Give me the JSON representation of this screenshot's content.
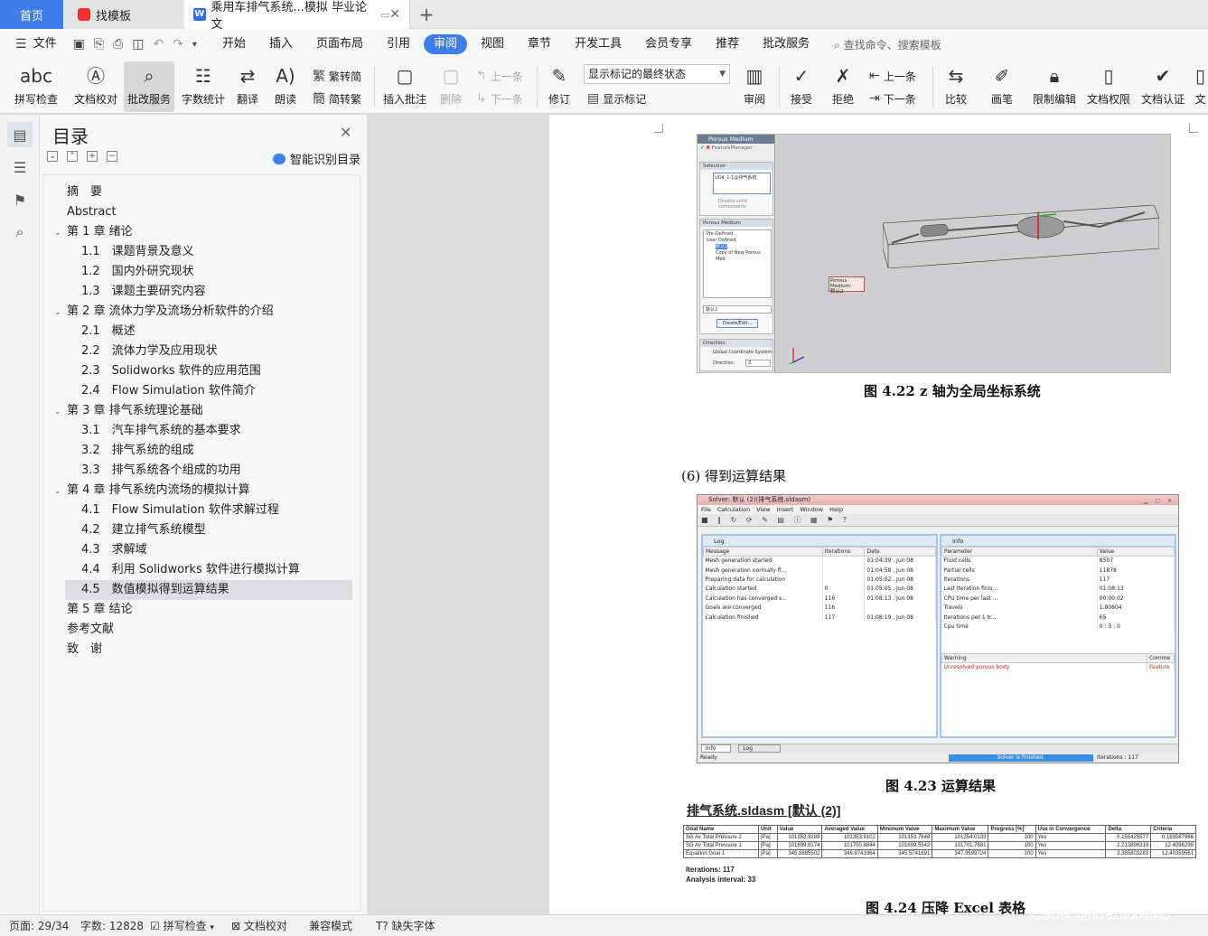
{
  "tabs": {
    "home": "首页",
    "template": "找模板",
    "document": "乘用车排气系统...模拟 毕业论文"
  },
  "menu": {
    "file": "文件",
    "items": [
      "开始",
      "插入",
      "页面布局",
      "引用",
      "审阅",
      "视图",
      "章节",
      "开发工具",
      "会员专享",
      "推荐",
      "批改服务"
    ],
    "active": "审阅",
    "search": "查找命令、搜索模板"
  },
  "ribbon": {
    "spell": "拼写检查",
    "doc_check": "文档校对",
    "correct": "批改服务",
    "word_count": "字数统计",
    "translate": "翻译",
    "read": "朗读",
    "trad": "繁转简",
    "simp": "简转繁",
    "insert_comment": "插入批注",
    "delete": "删除",
    "prev": "上一条",
    "next": "下一条",
    "revise": "修订",
    "markup_state": "显示标记的最终状态",
    "show_markup": "显示标记",
    "review": "审阅",
    "accept": "接受",
    "reject": "拒绝",
    "prev2": "上一条",
    "next2": "下一条",
    "compare": "比较",
    "pen": "画笔",
    "restrict": "限制编辑",
    "perm": "文档权限",
    "cert": "文档认证",
    "more": "文"
  },
  "toc": {
    "title": "目录",
    "smart": "智能识别目录",
    "items": [
      {
        "label": "摘　要",
        "level": 1,
        "arrow": false
      },
      {
        "label": "Abstract",
        "level": 1,
        "arrow": false
      },
      {
        "label": "第 1 章  绪论",
        "level": 1,
        "arrow": true
      },
      {
        "label": "1.1　课题背景及意义",
        "level": 2,
        "arrow": false
      },
      {
        "label": "1.2　国内外研究现状",
        "level": 2,
        "arrow": false
      },
      {
        "label": "1.3　课题主要研究内容",
        "level": 2,
        "arrow": false
      },
      {
        "label": "第 2 章  流体力学及流场分析软件的介绍",
        "level": 1,
        "arrow": true
      },
      {
        "label": "2.1　概述",
        "level": 2,
        "arrow": false
      },
      {
        "label": "2.2　流体力学及应用现状",
        "level": 2,
        "arrow": false
      },
      {
        "label": "2.3　Solidworks 软件的应用范围",
        "level": 2,
        "arrow": false
      },
      {
        "label": "2.4　Flow Simulation  软件简介",
        "level": 2,
        "arrow": false
      },
      {
        "label": "第 3 章  排气系统理论基础",
        "level": 1,
        "arrow": true
      },
      {
        "label": "3.1　汽车排气系统的基本要求",
        "level": 2,
        "arrow": false
      },
      {
        "label": "3.2　排气系统的组成",
        "level": 2,
        "arrow": false
      },
      {
        "label": "3.3　排气系统各个组成的功用",
        "level": 2,
        "arrow": false
      },
      {
        "label": "第 4 章  排气系统内流场的模拟计算",
        "level": 1,
        "arrow": true
      },
      {
        "label": "4.1　Flow Simulation 软件求解过程",
        "level": 2,
        "arrow": false
      },
      {
        "label": "4.2　建立排气系统模型",
        "level": 2,
        "arrow": false
      },
      {
        "label": "4.3　求解域",
        "level": 2,
        "arrow": false
      },
      {
        "label": "4.4　利用 Solidworks 软件进行模拟计算",
        "level": 2,
        "arrow": false
      },
      {
        "label": "4.5　数值模拟得到运算结果",
        "level": 2,
        "arrow": false,
        "selected": true
      },
      {
        "label": "第 5 章  结论",
        "level": 1,
        "arrow": false
      },
      {
        "label": "参考文献",
        "level": 1,
        "arrow": false
      },
      {
        "label": "致　谢",
        "level": 1,
        "arrow": false
      }
    ]
  },
  "page": {
    "fig1": {
      "panel_title": "Porous Medium",
      "feature_manager": "FeatureManager",
      "selection": "Selection",
      "selected_item": "UD4_1-1@排气系统",
      "disable_solid": "Disable solid components",
      "pm_section": "Porous Medium",
      "pre_defined": "Pre-Defined",
      "user_defined": "User Defined",
      "item_default": "默认2",
      "item_copy": "Copy of New Porous Med",
      "select_value": "默认2",
      "create_edit": "Create/Edit...",
      "direction": "Direction",
      "global_coord": "Global Coordinate System",
      "dir_label": "Direction:",
      "dir_value": "Z",
      "callout_title": "Porous Medium",
      "callout_value": "默认2"
    },
    "caption1": "图 4.22 z 轴为全局坐标系统",
    "step6": "(6)  得到运算结果",
    "fig2": {
      "title": "Solver: 默认 (2)(排气系统.sldasm)",
      "menu": "File  Calculation  View  Insert  Window  Help",
      "log_title": "Log",
      "info_title": "Info",
      "log_headers": [
        "Message",
        "Iterations",
        "Date"
      ],
      "log_rows": [
        [
          "Mesh generation started",
          "",
          "01:04:39 , Jun 08"
        ],
        [
          "Mesh generation normally fi...",
          "",
          "01:04:58 , Jun 08"
        ],
        [
          "Preparing data for calculation",
          "",
          "01:05:02 , Jun 08"
        ],
        [
          "Calculation started",
          "0",
          "01:05:05 , Jun 08"
        ],
        [
          "Calculation has converged s...",
          "116",
          "01:08:13 , Jun 08"
        ],
        [
          "    Goals are converged",
          "116",
          ""
        ],
        [
          "Calculation finished",
          "117",
          "01:08:19 , Jun 08"
        ]
      ],
      "info_headers": [
        "Parameter",
        "Value"
      ],
      "info_rows": [
        [
          "Fluid cells",
          "8507"
        ],
        [
          "Partial cells",
          "11878"
        ],
        [
          "Iterations",
          "117"
        ],
        [
          "Last iteration finis...",
          "01:08:13"
        ],
        [
          "CPU time per last ...",
          "00:00:02"
        ],
        [
          "Travels",
          "1.80804"
        ],
        [
          "Iterations per 1 tr...",
          "65"
        ],
        [
          "Cpu time",
          "0 : 3 : 0"
        ]
      ],
      "warning_headers": [
        "Warning",
        "Comme"
      ],
      "warning_row": [
        "Unresolved porous body",
        "Feature"
      ],
      "tab_info": "Info",
      "tab_log": "Log",
      "status_ready": "Ready",
      "status_solver": "Solver is finished.",
      "status_iters": "Iterations : 117"
    },
    "caption2": "图 4.23  运算结果",
    "excel": {
      "title": "排气系统.sldasm [默认 (2)]",
      "headers": [
        "Goal Name",
        "Unit",
        "Value",
        "Averaged Value",
        "Minimum Value",
        "Maximum Value",
        "Progress [%]",
        "Use In Convergence",
        "Delta",
        "Criteria"
      ],
      "rows": [
        [
          "SG Av Total Pressure 2",
          "[Pa]",
          "101353.9289",
          "101353.9102",
          "101353.7648",
          "101354.0133",
          "100",
          "Yes",
          "0.155425577",
          "0.159587966"
        ],
        [
          "SG Av Total Pressure 1",
          "[Pa]",
          "101699.8174",
          "101700.8844",
          "101699.5542",
          "101701.7681",
          "100",
          "Yes",
          "2.213896319",
          "12.4096299"
        ],
        [
          "Equation Goal 1",
          "[Pa]",
          "345.8885502",
          "346.9741964",
          "345.5741691",
          "347.9599724",
          "100",
          "Yes",
          "2.385803283",
          "12.40359561"
        ]
      ],
      "iterations": "Iterations:   117",
      "interval": "Analysis interval: 33"
    },
    "caption3": "图 4.24 压降 Excel 表格"
  },
  "status": {
    "page": "页面: 29/34",
    "words": "字数: 12828",
    "spell": "拼写检查",
    "check": "文档校对",
    "compat": "兼容模式",
    "font": "缺失字体"
  },
  "watermark": "CSDN @biyezuopinvip",
  "colors": {
    "accent": "#3f7ee8",
    "home_tab": "#3f7ee8",
    "selected_toc": "#dcdee3"
  }
}
